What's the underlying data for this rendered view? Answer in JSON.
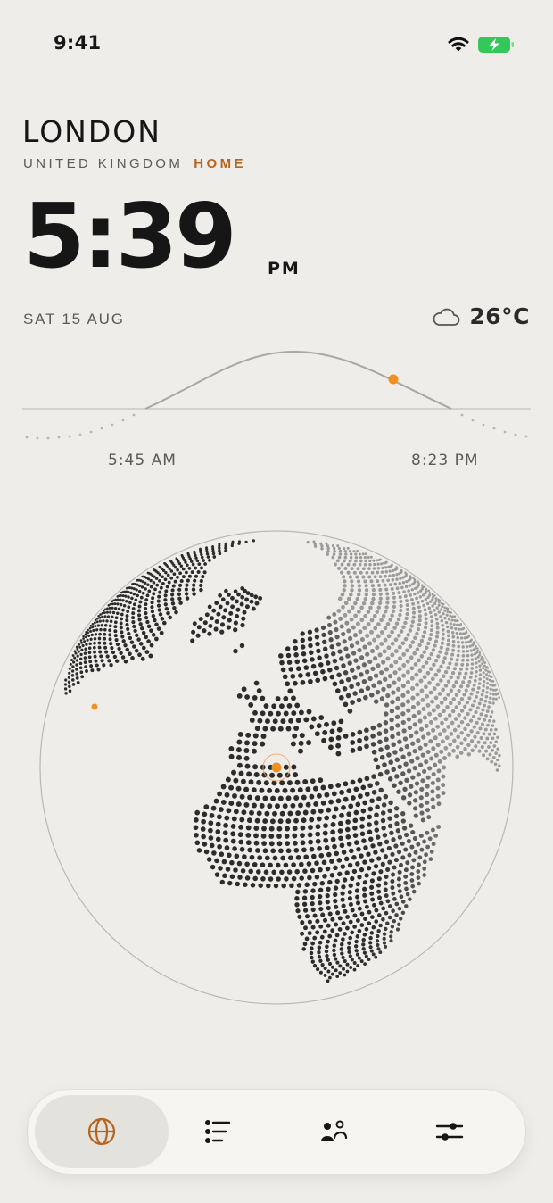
{
  "status_bar": {
    "time": "9:41"
  },
  "location": {
    "city": "LONDON",
    "country": "UNITED KINGDOM",
    "tag": "HOME"
  },
  "clock": {
    "time": "5:39",
    "ampm": "PM"
  },
  "date": "SAT 15 AUG",
  "weather": {
    "icon": "cloud-icon",
    "temperature": "26°C"
  },
  "sun": {
    "sunrise": "5:45 AM",
    "sunset": "8:23 PM"
  },
  "tabs": [
    {
      "name": "globe",
      "icon": "globe-icon",
      "active": true
    },
    {
      "name": "list",
      "icon": "list-icon",
      "active": false
    },
    {
      "name": "people",
      "icon": "people-icon",
      "active": false
    },
    {
      "name": "settings",
      "icon": "sliders-icon",
      "active": false
    }
  ],
  "colors": {
    "background": "#eeede9",
    "accent": "#f0901e",
    "accent_text": "#b5651d",
    "battery": "#34c759"
  }
}
